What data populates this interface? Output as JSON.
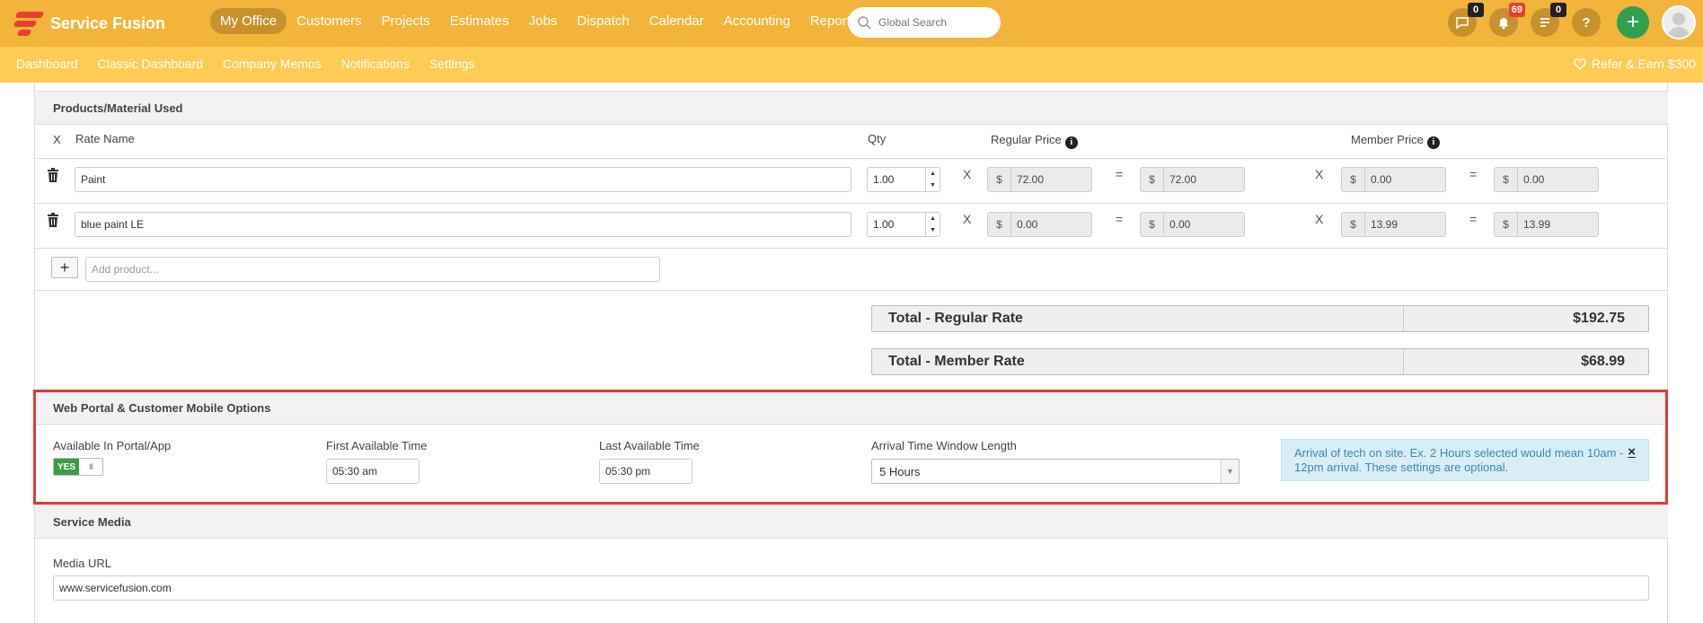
{
  "brand": {
    "name": "Service Fusion"
  },
  "nav": {
    "items": [
      "My Office",
      "Customers",
      "Projects",
      "Estimates",
      "Jobs",
      "Dispatch",
      "Calendar",
      "Accounting",
      "Reports"
    ],
    "active": "My Office"
  },
  "search": {
    "placeholder": "Global Search"
  },
  "header_icons": {
    "chat_badge": "0",
    "bell_badge": "69",
    "list_badge": "0",
    "help_label": "?",
    "add_label": "+"
  },
  "subnav": {
    "items": [
      "Dashboard",
      "Classic Dashboard",
      "Company Memos",
      "Notifications",
      "Settings"
    ],
    "refer": "Refer & Earn $300"
  },
  "products": {
    "title": "Products/Material Used",
    "headers": {
      "x": "X",
      "rate_name": "Rate Name",
      "qty": "Qty",
      "regular_price": "Regular Price",
      "member_price": "Member Price"
    },
    "rows": [
      {
        "name": "Paint",
        "qty": "1.00",
        "reg_price": "72.00",
        "reg_total": "72.00",
        "mem_price": "0.00",
        "mem_total": "0.00"
      },
      {
        "name": "blue paint LE",
        "qty": "1.00",
        "reg_price": "0.00",
        "reg_total": "0.00",
        "mem_price": "13.99",
        "mem_total": "13.99"
      }
    ],
    "currency": "$",
    "times_op": "X",
    "equals_op": "=",
    "add_button": "+",
    "add_placeholder": "Add product...",
    "totals": [
      {
        "label": "Total - Regular Rate",
        "value": "$192.75"
      },
      {
        "label": "Total - Member Rate",
        "value": "$68.99"
      }
    ]
  },
  "portal": {
    "title": "Web Portal & Customer Mobile Options",
    "available_label": "Available In Portal/App",
    "toggle_on": "YES",
    "toggle_knob": "III",
    "first_label": "First Available Time",
    "first_value": "05:30 am",
    "last_label": "Last Available Time",
    "last_value": "05:30 pm",
    "window_label": "Arrival Time Window Length",
    "window_value": "5 Hours",
    "info": "Arrival of tech on site. Ex. 2 Hours selected would mean 10am - 12pm arrival. These settings are optional.",
    "close": "×"
  },
  "media": {
    "title": "Service Media",
    "url_label": "Media URL",
    "url_value": "www.servicefusion.com"
  },
  "colors": {
    "topbar": "#f2b43a",
    "subbar": "#fecb55",
    "highlight": "#e03c3c",
    "toggle_on": "#3a9a48"
  }
}
